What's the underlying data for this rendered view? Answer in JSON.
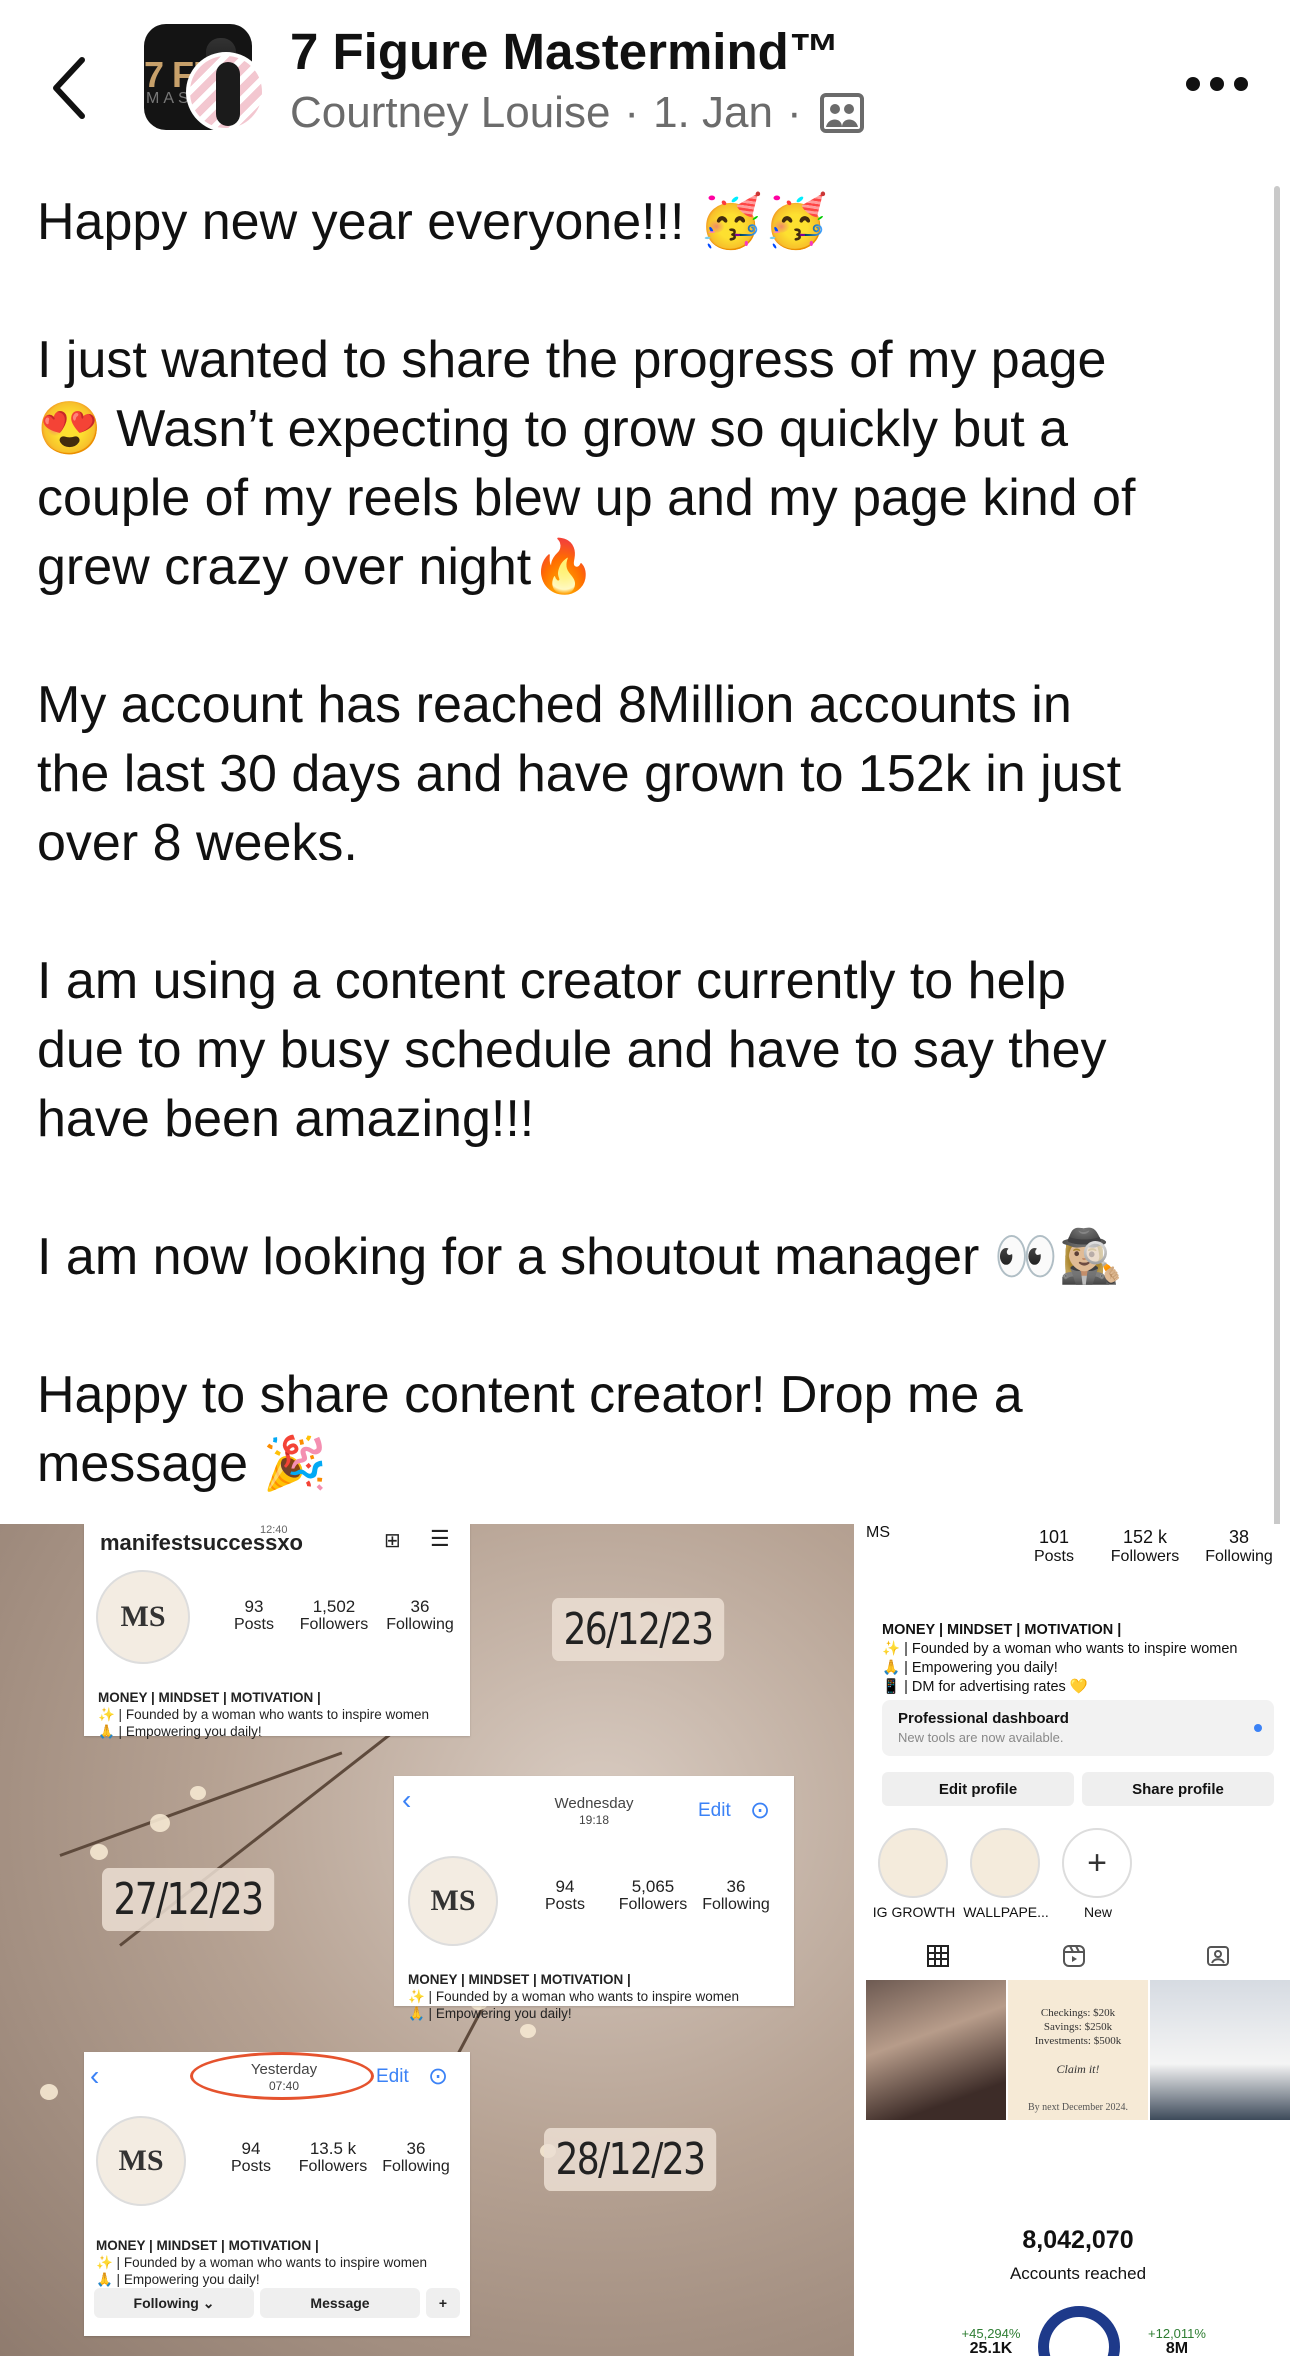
{
  "header": {
    "group_name": "7 Figure Mastermind™",
    "author": "Courtney Louise",
    "separator": "·",
    "date": "1. Jan",
    "group_logo_text": "7 FI",
    "group_logo_sub": "MAST"
  },
  "post": {
    "paragraphs": [
      "Happy new year everyone!!! 🥳🥳",
      "I just wanted to share the progress of my page\n😍 Wasn’t expecting to grow so quickly but a\ncouple of my reels blew up and my page kind of\ngrew crazy over night🔥",
      "My account has reached 8Million accounts in\nthe last 30 days and have grown to 152k in just\nover 8 weeks.",
      "I am using a content creator currently to help\ndue to my busy schedule and have to say they\nhave been amazing!!!",
      "I am now looking for a shoutout manager 👀🕵🏼‍♀️",
      "Happy to share content creator! Drop me a\nmessage 🎉"
    ]
  },
  "collage": {
    "card1": {
      "time": "12:40",
      "username": "manifestsuccessxo",
      "posts": "93",
      "followers": "1,502",
      "following": "36",
      "bio_title": "MONEY | MINDSET | MOTIVATION |",
      "bio": "✨ | Founded by a woman who wants to inspire women\n🙏 | Empowering you daily!"
    },
    "date1": "26/12/23",
    "card2": {
      "day": "Wednesday",
      "time": "19:18",
      "edit": "Edit",
      "posts": "94",
      "followers": "5,065",
      "following": "36",
      "bio_title": "MONEY | MINDSET | MOTIVATION |",
      "bio": "✨ | Founded by a woman who wants to inspire women\n🙏 | Empowering you daily!"
    },
    "date2": "27/12/23",
    "card3": {
      "day": "Yesterday",
      "time": "07:40",
      "edit": "Edit",
      "posts": "94",
      "followers": "13.5 k",
      "following": "36",
      "bio_title": "MONEY | MINDSET | MOTIVATION |",
      "bio": "✨ | Founded by a woman who wants to inspire women\n🙏 | Empowering you daily!",
      "following_btn": "Following ⌄",
      "message_btn": "Message"
    },
    "date3": "28/12/23",
    "stat_labels": {
      "posts": "Posts",
      "followers": "Followers",
      "following": "Following"
    },
    "monogram": "MS",
    "profile": {
      "posts": "101",
      "followers": "152 k",
      "following": "38",
      "bio_title": "MONEY | MINDSET | MOTIVATION |",
      "bio": "✨ | Founded by a woman who wants to inspire women\n🙏 | Empowering you daily!\n📱 | DM for advertising rates 💛",
      "dashboard_title": "Professional dashboard",
      "dashboard_sub": "New tools are now available.",
      "edit_profile": "Edit profile",
      "share_profile": "Share profile",
      "highlights": [
        "IG GROWTH",
        "WALLPAPE...",
        "New"
      ],
      "tile_text": "Checkings: $20k\nSavings: $250k\nInvestments: $500k",
      "tile_claim": "Claim it!",
      "tile_footer": "By next December 2024.",
      "accounts_reached_value": "8,042,070",
      "accounts_reached_label": "Accounts reached",
      "followers_change": "+45,294%",
      "followers_value": "25.1K",
      "nonfollowers_change": "+12,011%",
      "nonfollowers_value": "8M"
    }
  }
}
